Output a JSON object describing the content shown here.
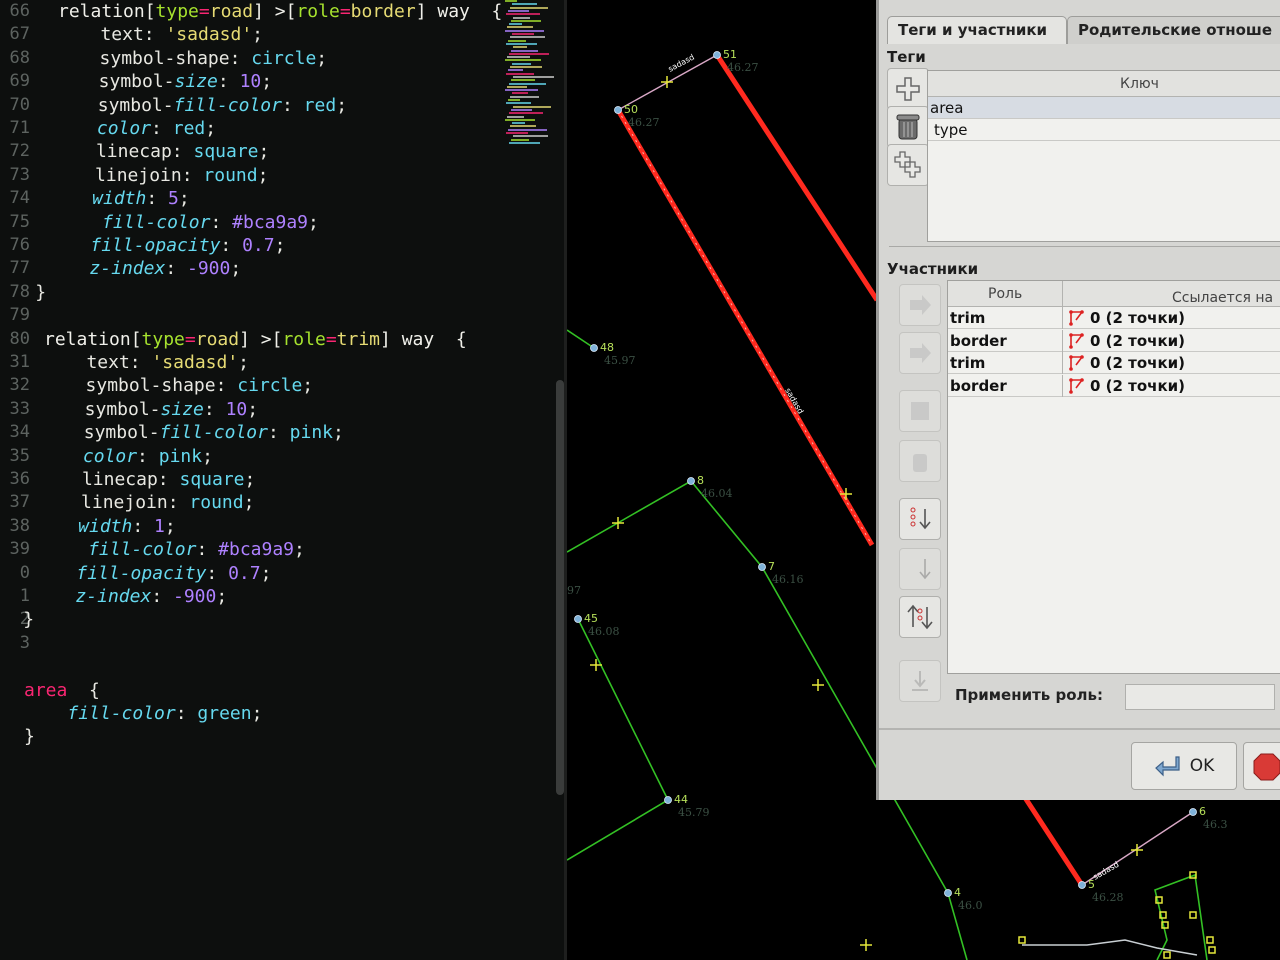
{
  "editor": {
    "line_numbers": [
      "66",
      "67",
      "68",
      "69",
      "70",
      "71",
      "72",
      "73",
      "74",
      "75",
      "76",
      "77",
      "78",
      "79",
      "80",
      "31",
      "32",
      "33",
      "34",
      "35",
      "36",
      "37",
      "38",
      "39",
      "0",
      "1",
      "2",
      "3",
      "",
      "",
      ""
    ],
    "code": [
      [
        [
          "relation[",
          "t-sel"
        ],
        [
          "type",
          "t-attr"
        ],
        [
          "=",
          "t-op"
        ],
        [
          "road",
          "t-val"
        ],
        [
          "] >[",
          "t-sel"
        ],
        [
          "role",
          "t-attr"
        ],
        [
          "=",
          "t-op"
        ],
        [
          "border",
          "t-val"
        ],
        [
          "] way  {",
          "t-sel"
        ]
      ],
      [
        [
          "    text: ",
          "t-prop"
        ],
        [
          "'sadasd'",
          "t-str"
        ],
        [
          ";",
          "t-p"
        ]
      ],
      [
        [
          "    symbol-shape: ",
          "t-prop"
        ],
        [
          "circle",
          "t-kw"
        ],
        [
          ";",
          "t-p"
        ]
      ],
      [
        [
          "    symbol-",
          "t-prop"
        ],
        [
          "size",
          "t-it"
        ],
        [
          ": ",
          "t-p"
        ],
        [
          "10",
          "t-num"
        ],
        [
          ";",
          "t-p"
        ]
      ],
      [
        [
          "    symbol-",
          "t-prop"
        ],
        [
          "fill-color",
          "t-it"
        ],
        [
          ": ",
          "t-p"
        ],
        [
          "red",
          "t-kw"
        ],
        [
          ";",
          "t-p"
        ]
      ],
      [
        [
          "    ",
          "t-p"
        ],
        [
          "color",
          "t-it"
        ],
        [
          ": ",
          "t-p"
        ],
        [
          "red",
          "t-kw"
        ],
        [
          ";",
          "t-p"
        ]
      ],
      [
        [
          "    linecap: ",
          "t-prop"
        ],
        [
          "square",
          "t-kw"
        ],
        [
          ";",
          "t-p"
        ]
      ],
      [
        [
          "    linejoin: ",
          "t-prop"
        ],
        [
          "round",
          "t-kw"
        ],
        [
          ";",
          "t-p"
        ]
      ],
      [
        [
          "    ",
          "t-p"
        ],
        [
          "width",
          "t-it"
        ],
        [
          ": ",
          "t-p"
        ],
        [
          "5",
          "t-num"
        ],
        [
          ";",
          "t-p"
        ]
      ],
      [
        [
          "     ",
          "t-p"
        ],
        [
          "fill-color",
          "t-it"
        ],
        [
          ": ",
          "t-p"
        ],
        [
          "#bca9a9",
          "t-num"
        ],
        [
          ";",
          "t-p"
        ]
      ],
      [
        [
          "    ",
          "t-p"
        ],
        [
          "fill-opacity",
          "t-it"
        ],
        [
          ": ",
          "t-p"
        ],
        [
          "0.7",
          "t-num"
        ],
        [
          ";",
          "t-p"
        ]
      ],
      [
        [
          "    ",
          "t-p"
        ],
        [
          "z-index",
          "t-it"
        ],
        [
          ": ",
          "t-p"
        ],
        [
          "-900",
          "t-num"
        ],
        [
          ";",
          "t-p"
        ]
      ],
      [
        [
          "}",
          "t-p"
        ]
      ],
      [
        [
          "",
          "t-p"
        ]
      ],
      [
        [
          "relation[",
          "t-sel"
        ],
        [
          "type",
          "t-attr"
        ],
        [
          "=",
          "t-op"
        ],
        [
          "road",
          "t-val"
        ],
        [
          "] >[",
          "t-sel"
        ],
        [
          "role",
          "t-attr"
        ],
        [
          "=",
          "t-op"
        ],
        [
          "trim",
          "t-val"
        ],
        [
          "] way  {",
          "t-sel"
        ]
      ],
      [
        [
          "    text: ",
          "t-prop"
        ],
        [
          "'sadasd'",
          "t-str"
        ],
        [
          ";",
          "t-p"
        ]
      ],
      [
        [
          "    symbol-shape: ",
          "t-prop"
        ],
        [
          "circle",
          "t-kw"
        ],
        [
          ";",
          "t-p"
        ]
      ],
      [
        [
          "    symbol-",
          "t-prop"
        ],
        [
          "size",
          "t-it"
        ],
        [
          ": ",
          "t-p"
        ],
        [
          "10",
          "t-num"
        ],
        [
          ";",
          "t-p"
        ]
      ],
      [
        [
          "    symbol-",
          "t-prop"
        ],
        [
          "fill-color",
          "t-it"
        ],
        [
          ": ",
          "t-p"
        ],
        [
          "pink",
          "t-kw"
        ],
        [
          ";",
          "t-p"
        ]
      ],
      [
        [
          "    ",
          "t-p"
        ],
        [
          "color",
          "t-it"
        ],
        [
          ": ",
          "t-p"
        ],
        [
          "pink",
          "t-kw"
        ],
        [
          ";",
          "t-p"
        ]
      ],
      [
        [
          "    linecap: ",
          "t-prop"
        ],
        [
          "square",
          "t-kw"
        ],
        [
          ";",
          "t-p"
        ]
      ],
      [
        [
          "    linejoin: ",
          "t-prop"
        ],
        [
          "round",
          "t-kw"
        ],
        [
          ";",
          "t-p"
        ]
      ],
      [
        [
          "    ",
          "t-p"
        ],
        [
          "width",
          "t-it"
        ],
        [
          ": ",
          "t-p"
        ],
        [
          "1",
          "t-num"
        ],
        [
          ";",
          "t-p"
        ]
      ],
      [
        [
          "     ",
          "t-p"
        ],
        [
          "fill-color",
          "t-it"
        ],
        [
          ": ",
          "t-p"
        ],
        [
          "#bca9a9",
          "t-num"
        ],
        [
          ";",
          "t-p"
        ]
      ],
      [
        [
          "    ",
          "t-p"
        ],
        [
          "fill-opacity",
          "t-it"
        ],
        [
          ": ",
          "t-p"
        ],
        [
          "0.7",
          "t-num"
        ],
        [
          ";",
          "t-p"
        ]
      ],
      [
        [
          "    ",
          "t-p"
        ],
        [
          "z-index",
          "t-it"
        ],
        [
          ": ",
          "t-p"
        ],
        [
          "-900",
          "t-num"
        ],
        [
          ";",
          "t-p"
        ]
      ],
      [
        [
          "}",
          "t-p"
        ]
      ],
      [
        [
          "",
          "t-p"
        ]
      ],
      [
        [
          "",
          "t-p"
        ]
      ],
      [
        [
          "area",
          "t-tag"
        ],
        [
          "  {",
          "t-p"
        ]
      ],
      [
        [
          "    ",
          "t-p"
        ],
        [
          "fill-color",
          "t-it"
        ],
        [
          ": ",
          "t-p"
        ],
        [
          "green",
          "t-kw"
        ],
        [
          ";",
          "t-p"
        ]
      ],
      [
        [
          "}",
          "t-p"
        ]
      ]
    ]
  },
  "map": {
    "nodes": [
      {
        "id": "51",
        "h": "46.27"
      },
      {
        "id": "50",
        "h": "46.27"
      },
      {
        "id": "48",
        "h": "45.97"
      },
      {
        "id": "8",
        "h": "46.04"
      },
      {
        "id": "7",
        "h": "46.16"
      },
      {
        "id": "45",
        "h": "46.08"
      },
      {
        "id": "44",
        "h": "45.79"
      },
      {
        "id": "4",
        "h": "46.0"
      },
      {
        "id": "5",
        "h": "46.28"
      },
      {
        "id": "6",
        "h": "46.3"
      },
      {
        "id": "",
        "h": "97"
      }
    ],
    "way_label": "sadasd"
  },
  "dialog": {
    "tabs": [
      "Теги и участники",
      "Родительские отноше"
    ],
    "tags_title": "Теги",
    "key_header": "Ключ",
    "tags": [
      "area",
      "type"
    ],
    "members_title": "Участники",
    "members_headers": [
      "Роль",
      "Ссылается на"
    ],
    "members": [
      {
        "role": "trim",
        "ref": "0 (2 точки)"
      },
      {
        "role": "border",
        "ref": "0 (2 точки)"
      },
      {
        "role": "trim",
        "ref": "0 (2 точки)"
      },
      {
        "role": "border",
        "ref": "0 (2 точки)"
      }
    ],
    "apply_role_label": "Применить роль:",
    "ok_label": "OK"
  },
  "colors": {
    "editor_bg": "#0d0f0e",
    "map_bg": "#000000",
    "red_way": "#ff2a1f",
    "green_way": "#33c024",
    "node": "#7fb2d9",
    "dialog_bg": "#d6d6d3"
  }
}
